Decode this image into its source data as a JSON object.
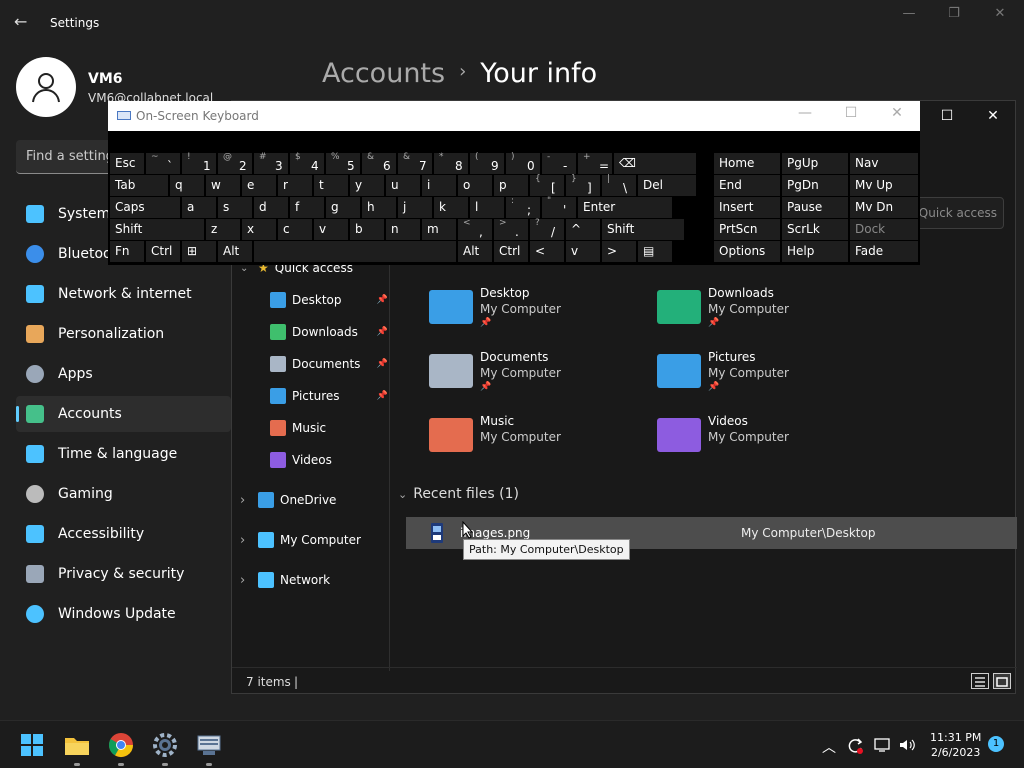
{
  "settings": {
    "title": "Settings",
    "user": {
      "name": "VM6",
      "email": "VM6@collabnet.local"
    },
    "breadcrumb": {
      "parent": "Accounts",
      "current": "Your info"
    },
    "search_placeholder": "Find a setting",
    "nav": [
      {
        "label": "System",
        "icon": "monitor-icon",
        "color": "#4cc2ff"
      },
      {
        "label": "Bluetooth & devices",
        "icon": "bluetooth-icon",
        "color": "#3b8eea"
      },
      {
        "label": "Network & internet",
        "icon": "wifi-icon",
        "color": "#4cc2ff"
      },
      {
        "label": "Personalization",
        "icon": "brush-icon",
        "color": "#e8a75a"
      },
      {
        "label": "Apps",
        "icon": "apps-icon",
        "color": "#9aa7b8"
      },
      {
        "label": "Accounts",
        "icon": "person-icon",
        "color": "#45c08a",
        "active": true
      },
      {
        "label": "Time & language",
        "icon": "clock-globe-icon",
        "color": "#4cc2ff"
      },
      {
        "label": "Gaming",
        "icon": "gamepad-icon",
        "color": "#bbbbbb"
      },
      {
        "label": "Accessibility",
        "icon": "accessibility-icon",
        "color": "#4cc2ff"
      },
      {
        "label": "Privacy & security",
        "icon": "shield-icon",
        "color": "#9aa7b8"
      },
      {
        "label": "Windows Update",
        "icon": "update-icon",
        "color": "#4cc2ff"
      }
    ]
  },
  "explorer": {
    "search_placeholder": "Search Quick access",
    "quick_access_label": "Quick access",
    "tree": [
      {
        "label": "Desktop",
        "color": "#3a9ee6",
        "pinned": true
      },
      {
        "label": "Downloads",
        "color": "#3fbf6d",
        "pinned": true
      },
      {
        "label": "Documents",
        "color": "#a9b6c6",
        "pinned": true
      },
      {
        "label": "Pictures",
        "color": "#3a9ee6",
        "pinned": true
      },
      {
        "label": "Music",
        "color": "#e46c4f",
        "pinned": false
      },
      {
        "label": "Videos",
        "color": "#8d5ce0",
        "pinned": false
      }
    ],
    "roots": [
      {
        "label": "OneDrive",
        "color": "#3a9ee6"
      },
      {
        "label": "My Computer",
        "color": "#4cc2ff"
      },
      {
        "label": "Network",
        "color": "#4cc2ff"
      }
    ],
    "folders": [
      {
        "name": "Desktop",
        "location": "My Computer",
        "pinned": true,
        "color": "#3a9ee6"
      },
      {
        "name": "Downloads",
        "location": "My Computer",
        "pinned": true,
        "color": "#23b07a"
      },
      {
        "name": "Documents",
        "location": "My Computer",
        "pinned": true,
        "color": "#a9b6c6"
      },
      {
        "name": "Pictures",
        "location": "My Computer",
        "pinned": true,
        "color": "#3a9ee6"
      },
      {
        "name": "Music",
        "location": "My Computer",
        "pinned": false,
        "color": "#e46c4f"
      },
      {
        "name": "Videos",
        "location": "My Computer",
        "pinned": false,
        "color": "#8d5ce0"
      }
    ],
    "recent_header": "Recent files (1)",
    "recent": [
      {
        "name": "images.png",
        "location": "My Computer\\Desktop"
      }
    ],
    "tooltip": "Path: My Computer\\Desktop",
    "status": "7 items"
  },
  "osk": {
    "title": "On-Screen Keyboard",
    "rows": [
      [
        {
          "p": "Esc"
        },
        {
          "s": "~",
          "m": "`"
        },
        {
          "s": "!",
          "m": "1"
        },
        {
          "s": "@",
          "m": "2"
        },
        {
          "s": "#",
          "m": "3"
        },
        {
          "s": "$",
          "m": "4"
        },
        {
          "s": "%",
          "m": "5"
        },
        {
          "s": "&",
          "m": "6"
        },
        {
          "s": "&",
          "m": "7"
        },
        {
          "s": "*",
          "m": "8"
        },
        {
          "s": "(",
          "m": "9"
        },
        {
          "s": ")",
          "m": "0"
        },
        {
          "s": "-",
          "m": "-"
        },
        {
          "s": "+",
          "m": "="
        },
        {
          "p": "⌫"
        }
      ],
      [
        {
          "p": "Tab"
        },
        {
          "p": "q"
        },
        {
          "p": "w"
        },
        {
          "p": "e"
        },
        {
          "p": "r"
        },
        {
          "p": "t"
        },
        {
          "p": "y"
        },
        {
          "p": "u"
        },
        {
          "p": "i"
        },
        {
          "p": "o"
        },
        {
          "p": "p"
        },
        {
          "s": "{",
          "m": "["
        },
        {
          "s": "}",
          "m": "]"
        },
        {
          "s": "|",
          "m": "\\"
        },
        {
          "p": "Del"
        }
      ],
      [
        {
          "p": "Caps"
        },
        {
          "p": "a"
        },
        {
          "p": "s"
        },
        {
          "p": "d"
        },
        {
          "p": "f"
        },
        {
          "p": "g"
        },
        {
          "p": "h"
        },
        {
          "p": "j"
        },
        {
          "p": "k"
        },
        {
          "p": "l"
        },
        {
          "s": ":",
          "m": ";"
        },
        {
          "s": "\"",
          "m": "'"
        },
        {
          "p": "Enter"
        }
      ],
      [
        {
          "p": "Shift"
        },
        {
          "p": "z"
        },
        {
          "p": "x"
        },
        {
          "p": "c"
        },
        {
          "p": "v"
        },
        {
          "p": "b"
        },
        {
          "p": "n"
        },
        {
          "p": "m"
        },
        {
          "s": "<",
          "m": ","
        },
        {
          "s": ">",
          "m": "."
        },
        {
          "s": "?",
          "m": "/"
        },
        {
          "p": "^"
        },
        {
          "p": "Shift"
        }
      ],
      [
        {
          "p": "Fn"
        },
        {
          "p": "Ctrl"
        },
        {
          "p": "⊞"
        },
        {
          "p": "Alt"
        },
        {
          "p": ""
        },
        {
          "p": "Alt"
        },
        {
          "p": "Ctrl"
        },
        {
          "p": "<"
        },
        {
          "p": "v"
        },
        {
          "p": ">"
        },
        {
          "p": "▤"
        }
      ]
    ],
    "nav_keys": [
      [
        "Home",
        "PgUp",
        "Nav"
      ],
      [
        "End",
        "PgDn",
        "Mv Up"
      ],
      [
        "Insert",
        "Pause",
        "Mv Dn"
      ],
      [
        "PrtScn",
        "ScrLk",
        "Dock"
      ],
      [
        "Options",
        "Help",
        "Fade"
      ]
    ]
  },
  "taskbar": {
    "time": "11:31 PM",
    "date": "2/6/2023",
    "notifications": "1"
  }
}
